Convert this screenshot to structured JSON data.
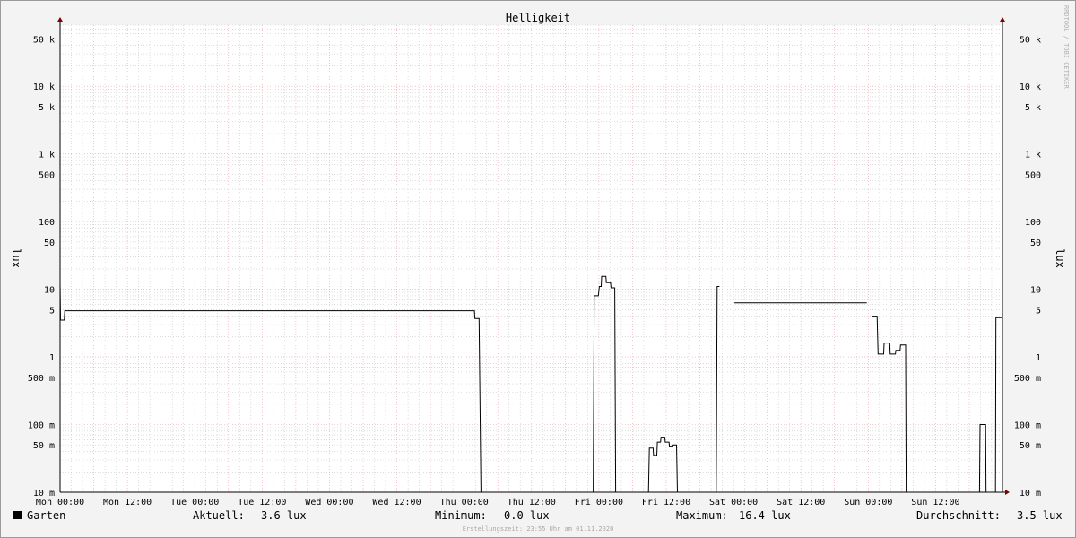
{
  "chart_data": {
    "type": "line",
    "title": "Helligkeit",
    "ylabel": "lux",
    "y_scale": "log",
    "ylim": [
      0.01,
      80000
    ],
    "xlim": [
      "2020-10-26T00:00",
      "2020-11-01T23:55"
    ],
    "grid": true,
    "x_tick_labels": [
      "Mon 00:00",
      "Mon 12:00",
      "Tue 00:00",
      "Tue 12:00",
      "Wed 00:00",
      "Wed 12:00",
      "Thu 00:00",
      "Thu 12:00",
      "Fri 00:00",
      "Fri 12:00",
      "Sat 00:00",
      "Sat 12:00",
      "Sun 00:00",
      "Sun 12:00"
    ],
    "x_tick_values": [
      "2020-10-26T00:00",
      "2020-10-26T12:00",
      "2020-10-27T00:00",
      "2020-10-27T12:00",
      "2020-10-28T00:00",
      "2020-10-28T12:00",
      "2020-10-29T00:00",
      "2020-10-29T12:00",
      "2020-10-30T00:00",
      "2020-10-30T12:00",
      "2020-10-31T00:00",
      "2020-10-31T12:00",
      "2020-11-01T00:00",
      "2020-11-01T12:00"
    ],
    "y_ticks": [
      {
        "value": 50000,
        "label": "50 k"
      },
      {
        "value": 10000,
        "label": "10 k"
      },
      {
        "value": 5000,
        "label": "5 k"
      },
      {
        "value": 1000,
        "label": "1 k"
      },
      {
        "value": 500,
        "label": "500"
      },
      {
        "value": 100,
        "label": "100"
      },
      {
        "value": 50,
        "label": "50"
      },
      {
        "value": 10,
        "label": "10"
      },
      {
        "value": 5,
        "label": "5"
      },
      {
        "value": 1,
        "label": "1"
      },
      {
        "value": 0.5,
        "label": "500 m"
      },
      {
        "value": 0.1,
        "label": "100 m"
      },
      {
        "value": 0.05,
        "label": "50 m"
      },
      {
        "value": 0.01,
        "label": "10 m"
      }
    ],
    "series": [
      {
        "name": "Garten",
        "color": "#000000",
        "segments": [
          [
            [
              "2020-10-26T00:00",
              12
            ],
            [
              "2020-10-26T00:05",
              3.5
            ],
            [
              "2020-10-26T00:45",
              3.5
            ],
            [
              "2020-10-26T00:50",
              4.8
            ],
            [
              "2020-10-29T01:50",
              4.8
            ],
            [
              "2020-10-29T01:55",
              3.7
            ],
            [
              "2020-10-29T02:40",
              3.7
            ],
            [
              "2020-10-29T03:00",
              0.01
            ],
            [
              "2020-10-29T23:00",
              0.01
            ],
            [
              "2020-10-29T23:10",
              8
            ],
            [
              "2020-10-29T23:55",
              8
            ],
            [
              "2020-10-30T00:05",
              11
            ],
            [
              "2020-10-30T00:25",
              11
            ],
            [
              "2020-10-30T00:30",
              15.5
            ],
            [
              "2020-10-30T01:15",
              15.5
            ],
            [
              "2020-10-30T01:20",
              12.5
            ],
            [
              "2020-10-30T02:05",
              12.5
            ],
            [
              "2020-10-30T02:10",
              10.5
            ],
            [
              "2020-10-30T02:50",
              10.5
            ],
            [
              "2020-10-30T03:00",
              0.01
            ],
            [
              "2020-10-30T08:50",
              0.01
            ],
            [
              "2020-10-30T09:00",
              0.045
            ],
            [
              "2020-10-30T09:40",
              0.045
            ],
            [
              "2020-10-30T09:45",
              0.035
            ],
            [
              "2020-10-30T10:20",
              0.035
            ],
            [
              "2020-10-30T10:25",
              0.055
            ],
            [
              "2020-10-30T11:00",
              0.055
            ],
            [
              "2020-10-30T11:05",
              0.065
            ],
            [
              "2020-10-30T11:45",
              0.065
            ],
            [
              "2020-10-30T11:50",
              0.055
            ],
            [
              "2020-10-30T12:30",
              0.055
            ],
            [
              "2020-10-30T12:35",
              0.048
            ],
            [
              "2020-10-30T13:10",
              0.048
            ],
            [
              "2020-10-30T13:15",
              0.05
            ],
            [
              "2020-10-30T13:50",
              0.05
            ],
            [
              "2020-10-30T14:00",
              0.01
            ],
            [
              "2020-10-30T20:55",
              0.01
            ],
            [
              "2020-10-30T21:05",
              11
            ],
            [
              "2020-10-30T21:30",
              11
            ]
          ],
          [
            [
              "2020-10-31T00:10",
              6.3
            ],
            [
              "2020-10-31T23:45",
              6.3
            ]
          ],
          [
            [
              "2020-11-01T00:45",
              4
            ],
            [
              "2020-11-01T01:35",
              4
            ],
            [
              "2020-11-01T01:45",
              1.1
            ],
            [
              "2020-11-01T02:45",
              1.1
            ],
            [
              "2020-11-01T02:50",
              1.6
            ],
            [
              "2020-11-01T03:50",
              1.6
            ],
            [
              "2020-11-01T03:55",
              1.1
            ],
            [
              "2020-11-01T04:50",
              1.1
            ],
            [
              "2020-11-01T04:55",
              1.25
            ],
            [
              "2020-11-01T05:40",
              1.25
            ],
            [
              "2020-11-01T05:45",
              1.5
            ],
            [
              "2020-11-01T06:40",
              1.5
            ],
            [
              "2020-11-01T06:45",
              0.01
            ],
            [
              "2020-11-01T19:50",
              0.01
            ],
            [
              "2020-11-01T19:55",
              0.1
            ],
            [
              "2020-11-01T20:55",
              0.1
            ],
            [
              "2020-11-01T21:00",
              0.01
            ],
            [
              "2020-11-01T22:40",
              0.01
            ],
            [
              "2020-11-01T22:45",
              3.8
            ],
            [
              "2020-11-01T23:55",
              3.8
            ]
          ]
        ]
      }
    ]
  },
  "watermark": "RRDTOOL / TOBI OETIKER",
  "legend": {
    "series_name": "Garten",
    "current_label": "Aktuell:",
    "current_value": "3.6 lux",
    "min_label": "Minimum:",
    "min_value": "0.0 lux",
    "max_label": "Maximum:",
    "max_value": "16.4 lux",
    "avg_label": "Durchschnitt:",
    "avg_value": "3.5 lux"
  },
  "footer": "Erstellungszeit: 23:55 Uhr am 01.11.2020",
  "colors": {
    "background": "#f3f3f3",
    "canvas": "#ffffff",
    "major_grid": "#e8a0a8",
    "minor_grid": "#c8c8c8",
    "axis": "#000000",
    "arrow": "#800000",
    "line": "#000000"
  }
}
